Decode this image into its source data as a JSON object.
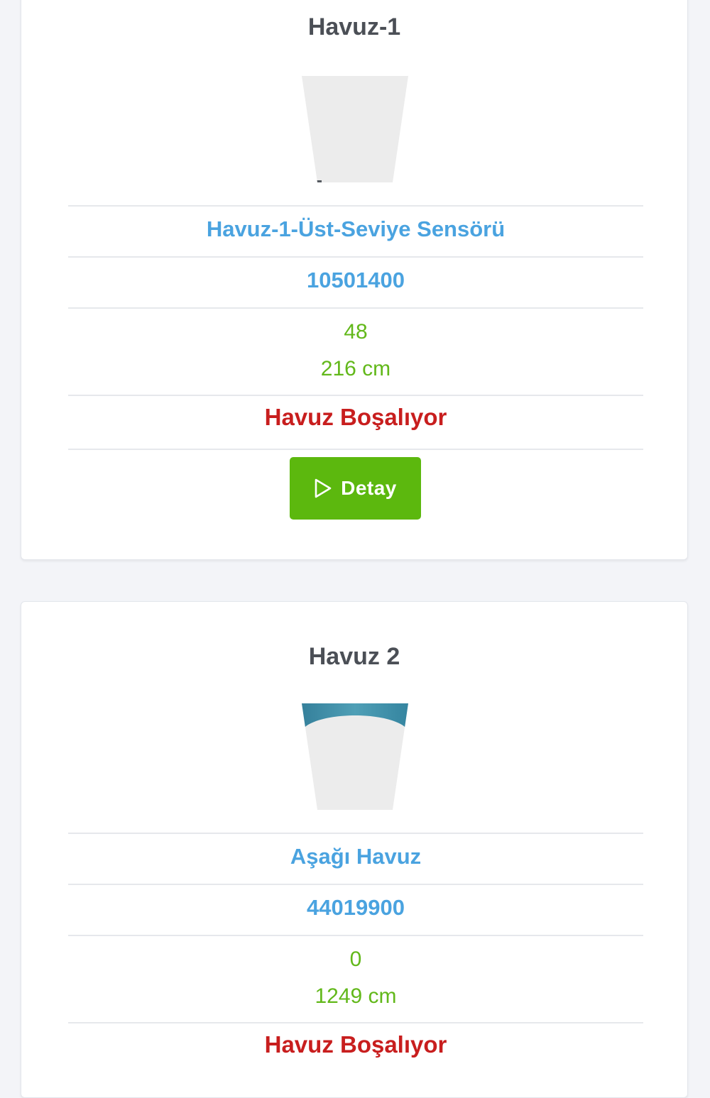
{
  "pools": [
    {
      "title": "Havuz-1",
      "fill_level": 0.02,
      "sensor_name": "Havuz-1-Üst-Seviye Sensörü",
      "sensor_id": "10501400",
      "value": "48",
      "distance": "216 cm",
      "status": "Havuz Boşalıyor",
      "button_label": "Detay"
    },
    {
      "title": "Havuz 2",
      "fill_level": 0.12,
      "sensor_name": "Aşağı Havuz",
      "sensor_id": "44019900",
      "value": "0",
      "distance": "1249 cm",
      "status": "Havuz Boşalıyor"
    }
  ],
  "colors": {
    "link_blue": "#4aa3e0",
    "value_green": "#62b81a",
    "status_red": "#c81e1e",
    "button_green": "#5cb80e",
    "water": "#3f8fa8",
    "tank_bg": "#ececec"
  },
  "icons": {
    "detail_button": "play-outline-icon"
  }
}
